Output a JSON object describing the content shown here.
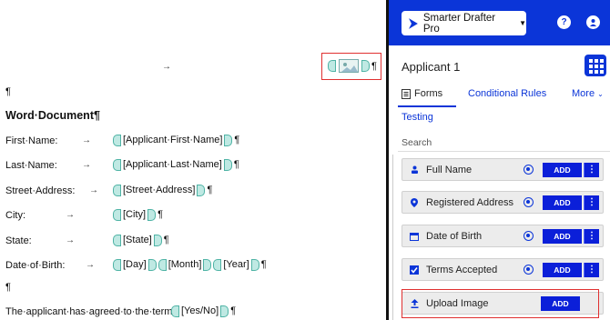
{
  "document": {
    "top_arrow": "→",
    "picture_pilcrow": "¶",
    "empty_para_1": "¶",
    "heading": "Word·Document¶",
    "rows": [
      {
        "label": "First·Name:",
        "arrow": "→",
        "placeholders": [
          "[Applicant·First·Name]"
        ],
        "end": "¶"
      },
      {
        "label": "Last·Name:",
        "arrow": "→",
        "placeholders": [
          "[Applicant·Last·Name]"
        ],
        "end": "¶"
      },
      {
        "label": "Street·Address:",
        "arrow": "→",
        "placeholders": [
          "[Street·Address]"
        ],
        "end": "¶"
      },
      {
        "label": "City:",
        "arrow": "→",
        "placeholders": [
          "[City]"
        ],
        "end": "¶"
      },
      {
        "label": "State:",
        "arrow": "→",
        "placeholders": [
          "[State]"
        ],
        "end": "¶"
      },
      {
        "label": "Date·of·Birth:",
        "arrow": "→",
        "placeholders": [
          "[Day]",
          "[Month]",
          "[Year]"
        ],
        "end": "¶"
      }
    ],
    "empty_para_2": "¶",
    "terms_text": "The·applicant·has·agreed·to·the·terms",
    "terms_placeholder": "[Yes/No]",
    "terms_end": "¶"
  },
  "panel": {
    "app_name": "Smarter Drafter Pro",
    "help_icon": "?",
    "title": "Applicant 1",
    "tabs": {
      "forms": "Forms",
      "conditional_rules": "Conditional Rules",
      "more": "More",
      "testing": "Testing"
    },
    "search_label": "Search",
    "fields": [
      {
        "label": "Full Name",
        "icon": "person-icon",
        "add": "ADD"
      },
      {
        "label": "Registered Address",
        "icon": "location-pin-icon",
        "add": "ADD"
      },
      {
        "label": "Date of Birth",
        "icon": "calendar-icon",
        "add": "ADD"
      },
      {
        "label": "Terms Accepted",
        "icon": "checkbox-icon",
        "add": "ADD"
      },
      {
        "label": "Upload Image",
        "icon": "upload-icon",
        "add": "ADD"
      }
    ],
    "colors": {
      "brand": "#0b35d8",
      "highlight": "#e03030",
      "content_control": "#bfe9e3"
    }
  }
}
